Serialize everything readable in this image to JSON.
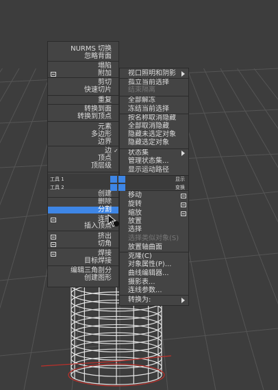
{
  "left_menu": {
    "items": [
      {
        "label": "NURMS 切换",
        "highlight": false,
        "box": false
      },
      {
        "label": "忽略背面",
        "highlight": false,
        "box": false
      },
      {
        "label": "塌陷",
        "highlight": false,
        "box": false
      },
      {
        "label": "附加",
        "highlight": false,
        "box": true
      },
      {
        "label": "剪切",
        "highlight": false,
        "box": false
      },
      {
        "label": "快速切片",
        "highlight": false,
        "box": false
      },
      {
        "label": "重复",
        "highlight": false,
        "box": false
      },
      {
        "label": "转换到面",
        "highlight": false,
        "box": false
      },
      {
        "label": "转换到顶点",
        "highlight": false,
        "box": false
      },
      {
        "label": "元素",
        "highlight": false,
        "box": false
      },
      {
        "label": "多边形",
        "highlight": false,
        "box": false
      },
      {
        "label": "边界",
        "highlight": false,
        "box": false
      },
      {
        "label": "边",
        "highlight": false,
        "box": false,
        "check": true
      },
      {
        "label": "顶点",
        "highlight": false,
        "box": false
      },
      {
        "label": "顶层级",
        "highlight": false,
        "box": false
      },
      {
        "label": "创建",
        "highlight": false,
        "box": false
      },
      {
        "label": "删除",
        "highlight": false,
        "box": false
      },
      {
        "label": "分割",
        "highlight": true,
        "box": false
      },
      {
        "label": "连接",
        "highlight": false,
        "box": true
      },
      {
        "label": "插入顶点",
        "highlight": false,
        "box": false
      },
      {
        "label": "挤出",
        "highlight": false,
        "box": true
      },
      {
        "label": "切角",
        "highlight": false,
        "box": true
      },
      {
        "label": "焊接",
        "highlight": false,
        "box": true
      },
      {
        "label": "目标焊接",
        "highlight": false,
        "box": false
      },
      {
        "label": "编辑三角剖分",
        "highlight": false,
        "box": false
      },
      {
        "label": "创建图形",
        "highlight": false,
        "box": false
      }
    ]
  },
  "right_menu": {
    "items": [
      {
        "label": "视口照明和阴影",
        "submenu": true,
        "box": false,
        "disabled": false
      },
      {
        "label": "孤立当前选择",
        "submenu": false,
        "box": false,
        "disabled": false
      },
      {
        "label": "结束隔离",
        "submenu": false,
        "box": false,
        "disabled": true
      },
      {
        "label": "全部解冻",
        "submenu": false,
        "box": false,
        "disabled": false
      },
      {
        "label": "冻结当前选择",
        "submenu": false,
        "box": false,
        "disabled": false
      },
      {
        "label": "按名称取消隐藏",
        "submenu": false,
        "box": false,
        "disabled": false
      },
      {
        "label": "全部取消隐藏",
        "submenu": false,
        "box": false,
        "disabled": false
      },
      {
        "label": "隐藏未选定对象",
        "submenu": false,
        "box": false,
        "disabled": false
      },
      {
        "label": "隐藏选定对象",
        "submenu": false,
        "box": false,
        "disabled": false
      },
      {
        "label": "状态集",
        "submenu": true,
        "box": false,
        "disabled": false
      },
      {
        "label": "管理状态集...",
        "submenu": false,
        "box": false,
        "disabled": false
      },
      {
        "label": "显示运动路径",
        "submenu": false,
        "box": false,
        "disabled": false
      },
      {
        "label": "移动",
        "submenu": false,
        "box": true,
        "disabled": false
      },
      {
        "label": "旋转",
        "submenu": false,
        "box": true,
        "disabled": false
      },
      {
        "label": "缩放",
        "submenu": false,
        "box": true,
        "disabled": false
      },
      {
        "label": "放置",
        "submenu": false,
        "box": false,
        "disabled": false
      },
      {
        "label": "选择",
        "submenu": false,
        "box": false,
        "disabled": false
      },
      {
        "label": "选择类似对象(S)",
        "submenu": false,
        "box": false,
        "disabled": true
      },
      {
        "label": "放置轴曲面",
        "submenu": false,
        "box": false,
        "disabled": false
      },
      {
        "label": "克隆(C)",
        "submenu": false,
        "box": false,
        "disabled": false
      },
      {
        "label": "对象属性(P)...",
        "submenu": false,
        "box": false,
        "disabled": false
      },
      {
        "label": "曲线编辑器...",
        "submenu": false,
        "box": false,
        "disabled": false
      },
      {
        "label": "摄影表...",
        "submenu": false,
        "box": false,
        "disabled": false
      },
      {
        "label": "连线参数...",
        "submenu": false,
        "box": false,
        "disabled": false
      },
      {
        "label": "转换为:",
        "submenu": true,
        "box": false,
        "disabled": false
      }
    ]
  },
  "quad_headers": {
    "tools1": "工具 1",
    "tools2": "工具 2",
    "display": "显示",
    "transform": "变换"
  },
  "colors": {
    "highlight": "#3e86e6",
    "menu_bg": "#444444",
    "viewport_bg": "#3d3d3d",
    "axis_red": "#c0302a"
  }
}
